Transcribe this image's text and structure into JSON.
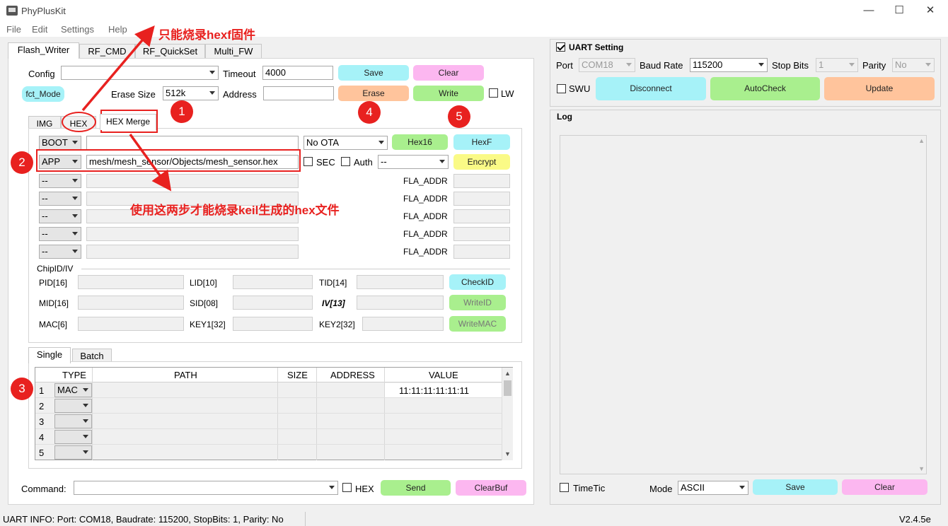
{
  "window": {
    "title": "PhyPlusKit",
    "minimize": "—",
    "maximize": "☐",
    "close": "✕"
  },
  "menu": [
    "File",
    "Edit",
    "Settings",
    "Help"
  ],
  "tabs": [
    "Flash_Writer",
    "RF_CMD",
    "RF_QuickSet",
    "Multi_FW"
  ],
  "config": {
    "config_label": "Config",
    "config_value": "",
    "timeout_label": "Timeout",
    "timeout_value": "4000",
    "save": "Save",
    "clear": "Clear",
    "fct_mode": "fct_Mode",
    "erase_size_label": "Erase Size",
    "erase_size_value": "512k",
    "address_label": "Address",
    "address_value": "",
    "erase": "Erase",
    "write": "Write",
    "lw": "LW"
  },
  "subtabs": [
    "IMG",
    "HEX",
    "HEX Merge"
  ],
  "hexmerge": {
    "boot_sel": "BOOT",
    "boot_path": "",
    "ota_sel": "No OTA",
    "hex16": "Hex16",
    "hexf": "HexF",
    "app_sel": "APP",
    "app_path": "mesh/mesh_sensor/Objects/mesh_sensor.hex",
    "sec": "SEC",
    "auth": "Auth",
    "auth_sel": "--",
    "encrypt": "Encrypt",
    "rows": [
      {
        "sel": "--",
        "fla": "FLA_ADDR"
      },
      {
        "sel": "--",
        "fla": "FLA_ADDR"
      },
      {
        "sel": "--",
        "fla": "FLA_ADDR"
      },
      {
        "sel": "--",
        "fla": "FLA_ADDR"
      },
      {
        "sel": "--",
        "fla": "FLA_ADDR"
      }
    ]
  },
  "chipid": {
    "title": "ChipID/IV",
    "pid": "PID[16]",
    "lid": "LID[10]",
    "tid": "TID[14]",
    "checkid": "CheckID",
    "mid": "MID[16]",
    "sid": "SID[08]",
    "iv": "IV[13]",
    "writeid": "WriteID",
    "mac": "MAC[6]",
    "key1": "KEY1[32]",
    "key2": "KEY2[32]",
    "writemac": "WriteMAC"
  },
  "bottom_tabs": [
    "Single",
    "Batch"
  ],
  "table": {
    "headers": [
      "TYPE",
      "PATH",
      "SIZE",
      "ADDRESS",
      "VALUE"
    ],
    "rows": [
      {
        "n": "1",
        "type": "MAC",
        "value": "11:11:11:11:11:11"
      },
      {
        "n": "2",
        "type": "",
        "value": ""
      },
      {
        "n": "3",
        "type": "",
        "value": ""
      },
      {
        "n": "4",
        "type": "",
        "value": ""
      },
      {
        "n": "5",
        "type": "",
        "value": ""
      }
    ]
  },
  "command": {
    "label": "Command:",
    "value": "",
    "hex": "HEX",
    "send": "Send",
    "clearbuf": "ClearBuf"
  },
  "uart": {
    "title": "UART Setting",
    "port_label": "Port",
    "port_value": "COM18",
    "baud_label": "Baud Rate",
    "baud_value": "115200",
    "stop_label": "Stop Bits",
    "stop_value": "1",
    "parity_label": "Parity",
    "parity_value": "No",
    "swu": "SWU",
    "disconnect": "Disconnect",
    "autocheck": "AutoCheck",
    "update": "Update"
  },
  "log": {
    "title": "Log",
    "timetic": "TimeTic",
    "mode_label": "Mode",
    "mode_value": "ASCII",
    "save": "Save",
    "clear": "Clear"
  },
  "status": {
    "info": "UART INFO:  Port: COM18, Baudrate: 115200, StopBits: 1, Parity: No",
    "version": "V2.4.5e"
  },
  "annotations": {
    "top": "只能烧录hexf固件",
    "mid": "使用这两步才能烧录keil生成的hex文件",
    "n1": "1",
    "n2": "2",
    "n3": "3",
    "n4": "4",
    "n5": "5"
  },
  "colors": {
    "cyan": "#a6f2f8",
    "pink": "#fcb7f0",
    "orange": "#ffc49c",
    "green": "#a9ef8e",
    "yellow": "#fafa86",
    "annotation_red": "#e8211f"
  }
}
